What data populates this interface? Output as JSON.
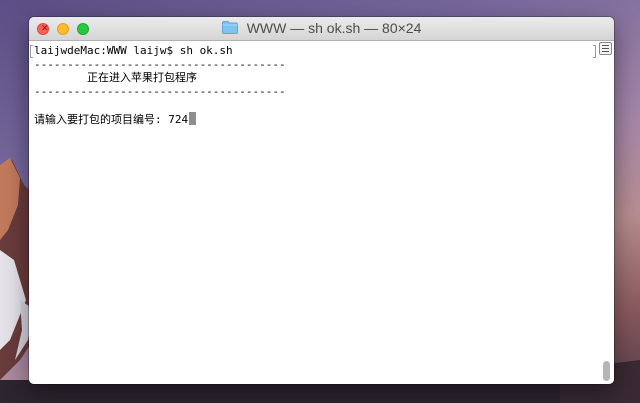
{
  "window": {
    "title": "WWW — sh ok.sh — 80×24",
    "folder_icon": "folder-icon"
  },
  "terminal": {
    "lines": [
      "laijwdeMac:WWW laijw$ sh ok.sh",
      "--------------------------------------",
      "        正在进入苹果打包程序",
      "--------------------------------------",
      "",
      "请输入要打包的项目编号: 724"
    ],
    "cursor": "block"
  },
  "colors": {
    "close": "#fc5f57",
    "minimize": "#fdbc2e",
    "zoom": "#28c840",
    "terminal_bg": "#ffffff",
    "terminal_text": "#000000"
  }
}
